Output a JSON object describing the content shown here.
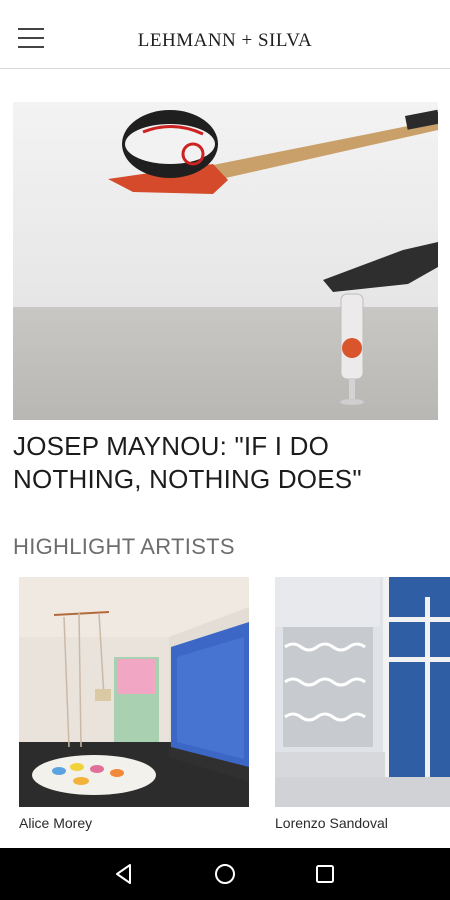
{
  "header": {
    "brand": "LEHMANN + SILVA",
    "menu_icon": "hamburger-menu-icon"
  },
  "hero": {
    "title": "JOSEP MAYNOU: \"IF I DO NOTHING, NOTHING DOES\""
  },
  "highlights": {
    "section_title": "HIGHLIGHT ARTISTS",
    "artists": [
      {
        "name": "Alice Morey"
      },
      {
        "name": "Lorenzo Sandoval"
      }
    ]
  },
  "navbar": {
    "back_icon": "back-triangle-icon",
    "home_icon": "home-circle-icon",
    "recent_icon": "recent-apps-square-icon"
  }
}
